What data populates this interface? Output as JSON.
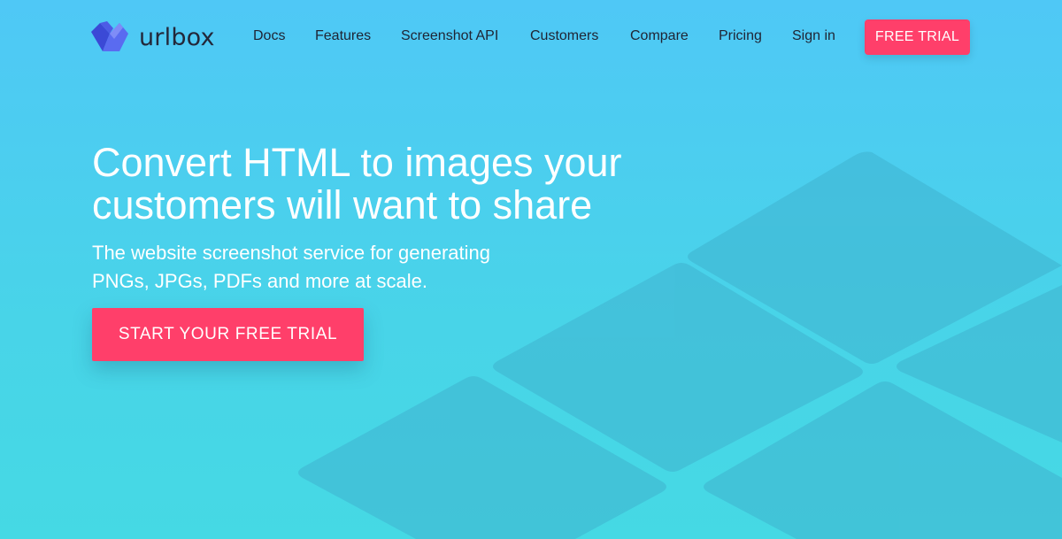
{
  "brand": {
    "name": "urlbox",
    "logo_colors": [
      "#3b49d6",
      "#5a6bf0",
      "#7f8cf7"
    ]
  },
  "nav": {
    "links": [
      {
        "label": "Docs"
      },
      {
        "label": "Features"
      },
      {
        "label": "Screenshot API"
      },
      {
        "label": "Customers"
      },
      {
        "label": "Compare"
      },
      {
        "label": "Pricing"
      },
      {
        "label": "Sign in"
      }
    ],
    "cta_label": "FREE TRIAL"
  },
  "hero": {
    "title_line1": "Convert HTML to images your",
    "title_line2": "customers will want to share",
    "subtitle_line1": "The website screenshot service for generating",
    "subtitle_line2": "PNGs, JPGs, PDFs and more at scale.",
    "cta_label": "START YOUR FREE TRIAL"
  },
  "colors": {
    "accent": "#ff3f6a",
    "background_top": "#4fc8f6",
    "background_bottom": "#45d9e4",
    "nav_text": "#1f2433"
  }
}
